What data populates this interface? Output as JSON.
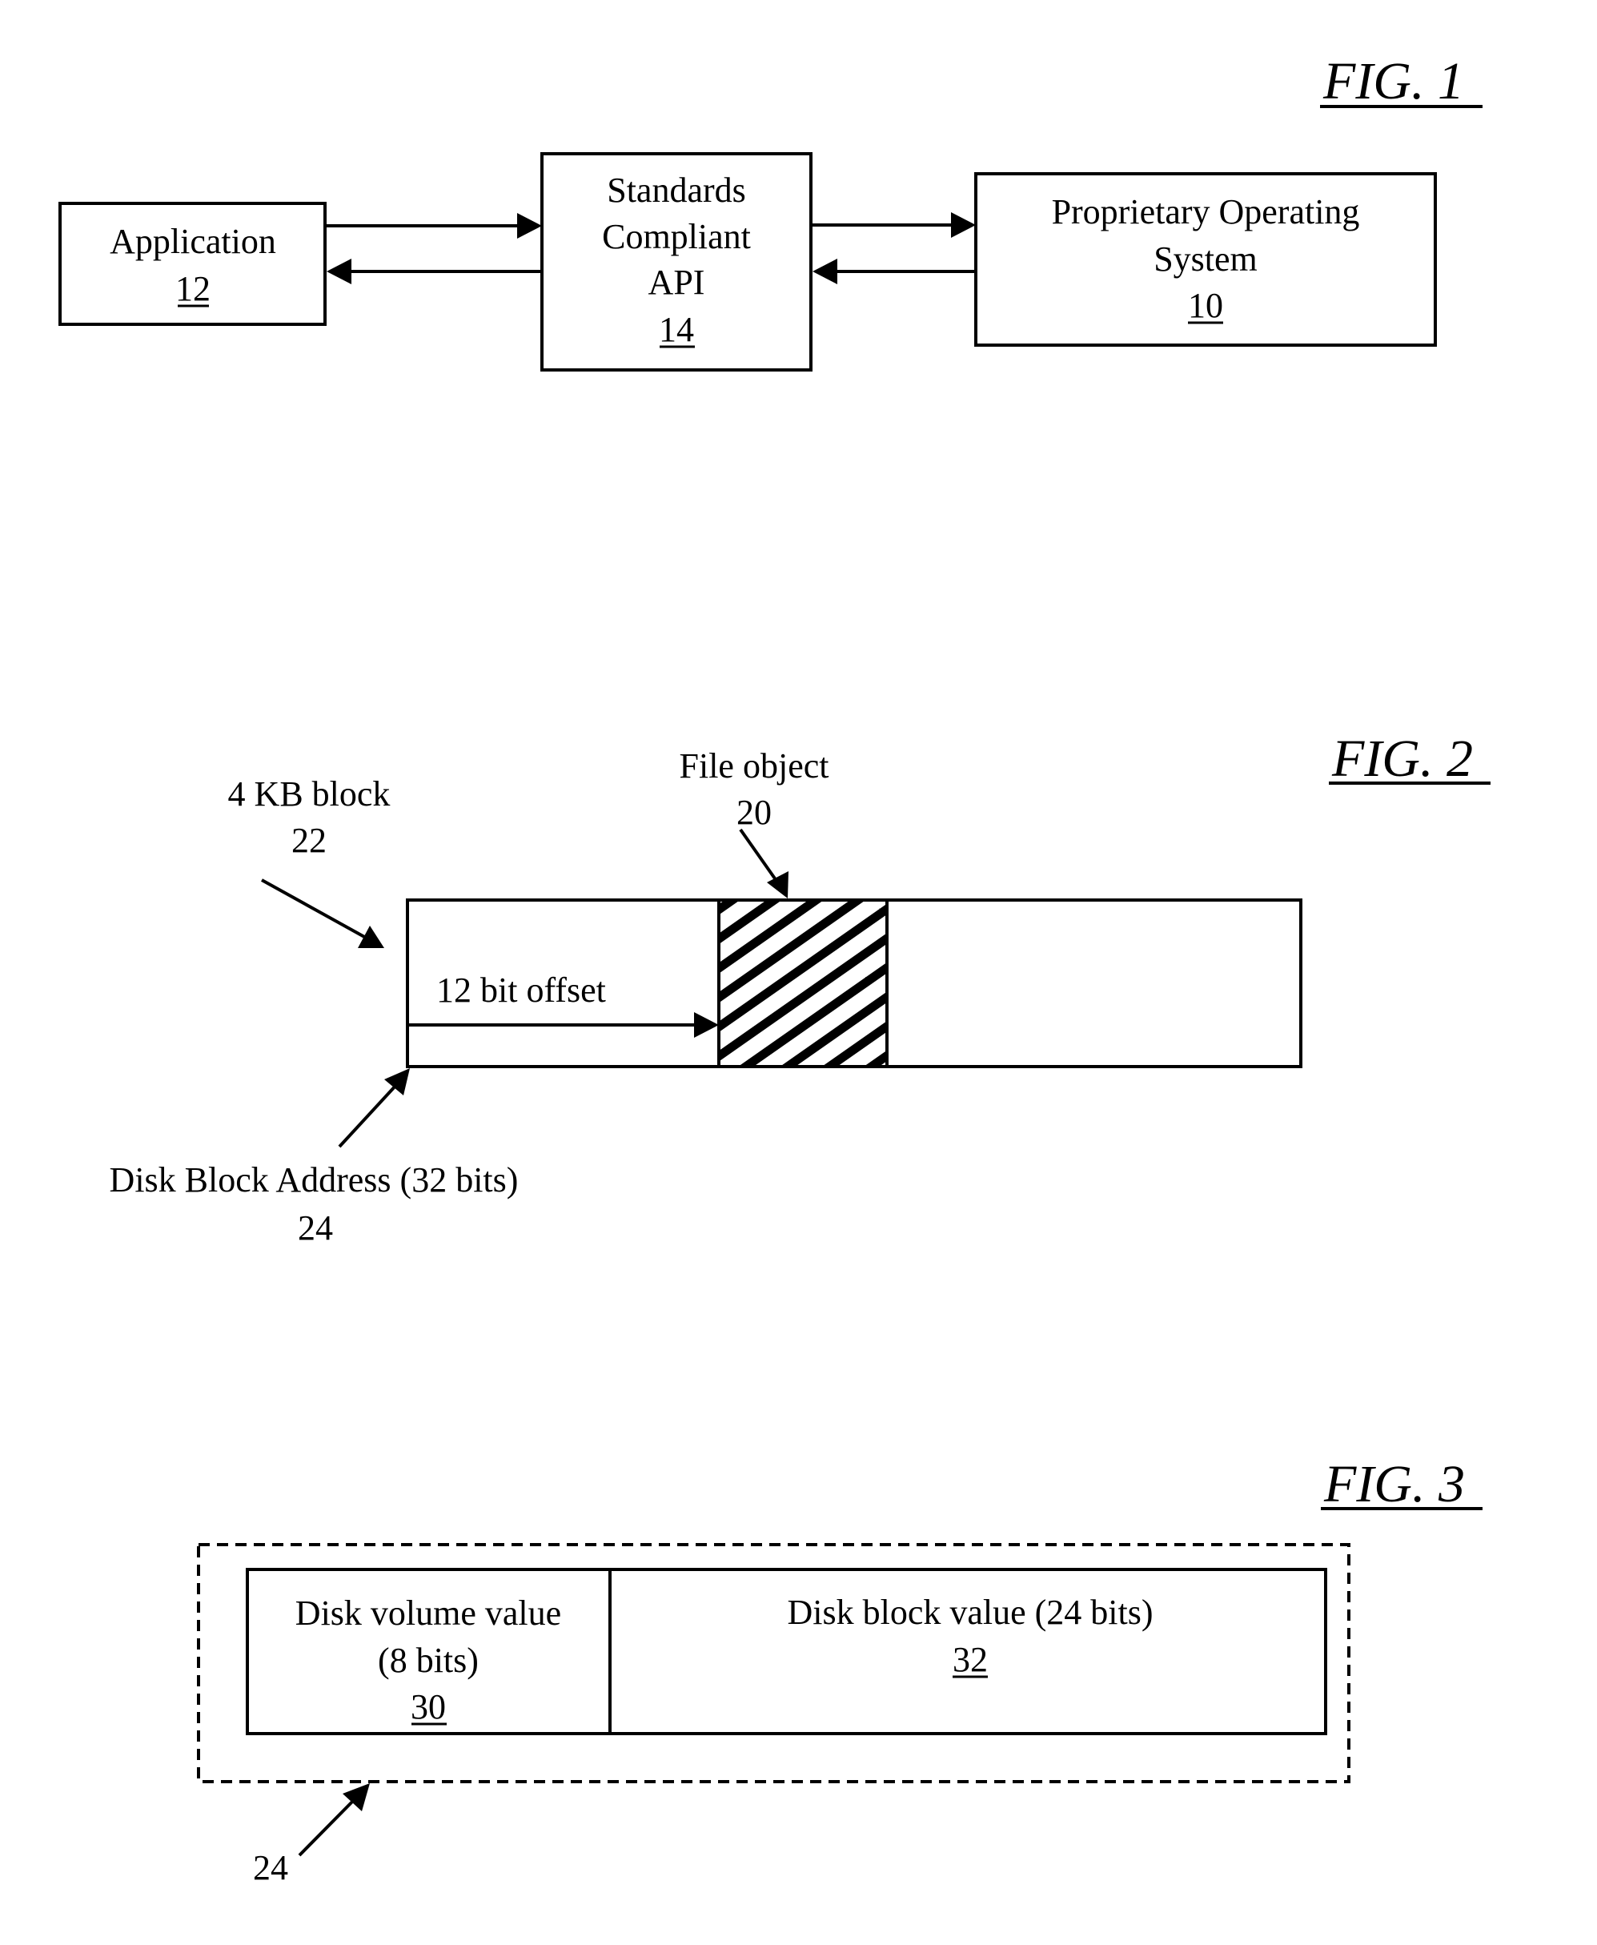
{
  "colors": {
    "ink": "#000000",
    "paper": "#ffffff"
  },
  "fig1": {
    "title": "FIG. 1",
    "application": {
      "lines": [
        "Application"
      ],
      "ref": "12"
    },
    "api": {
      "lines": [
        "Standards",
        "Compliant",
        "API"
      ],
      "ref": "14"
    },
    "os": {
      "lines": [
        "Proprietary Operating",
        "System"
      ],
      "ref": "10"
    },
    "connections": [
      {
        "from": "application",
        "to": "api"
      },
      {
        "from": "api",
        "to": "application"
      },
      {
        "from": "api",
        "to": "os"
      },
      {
        "from": "os",
        "to": "api"
      }
    ]
  },
  "fig2": {
    "title": "FIG. 2",
    "block_label": "4 KB block",
    "block_ref": "22",
    "file_object_label": "File object",
    "file_object_ref": "20",
    "offset_label": "12 bit offset",
    "address_label": "Disk Block Address (32 bits)",
    "address_ref": "24"
  },
  "fig3": {
    "title": "FIG. 3",
    "volume": {
      "lines": [
        "Disk volume value",
        "(8 bits)"
      ],
      "ref": "30"
    },
    "block": {
      "lines": [
        "Disk block value (24 bits)"
      ],
      "ref": "32"
    },
    "container_ref": "24"
  }
}
